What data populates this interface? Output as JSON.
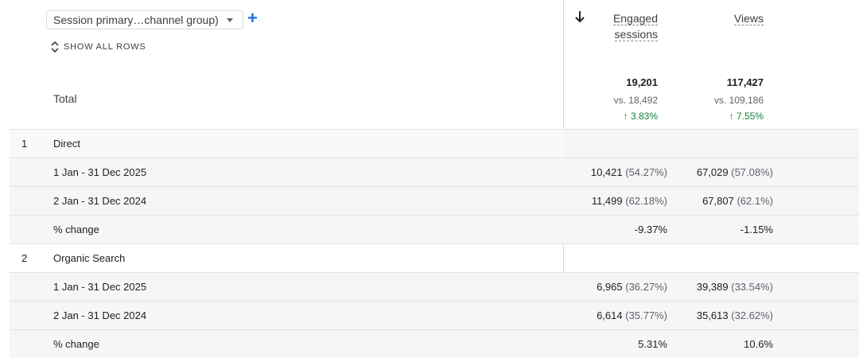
{
  "dimension_selector": {
    "label": "Session primary…channel group)"
  },
  "show_all_rows": {
    "label": "SHOW ALL ROWS"
  },
  "columns": [
    {
      "label_line1": "Engaged",
      "label_line2": "sessions"
    },
    {
      "label_line1": "Views",
      "label_line2": ""
    }
  ],
  "total": {
    "label": "Total",
    "engaged_sessions": {
      "value": "19,201",
      "vs": "vs. 18,492",
      "change": "↑ 3.83%"
    },
    "views": {
      "value": "117,427",
      "vs": "vs. 109,186",
      "change": "↑ 7.55%"
    }
  },
  "groups": [
    {
      "index": "1",
      "name": "Direct",
      "rows": [
        {
          "label": "1 Jan - 31 Dec 2025",
          "c1_val": "10,421",
          "c1_pct": "(54.27%)",
          "c2_val": "67,029",
          "c2_pct": "(57.08%)"
        },
        {
          "label": "2 Jan - 31 Dec 2024",
          "c1_val": "11,499",
          "c1_pct": "(62.18%)",
          "c2_val": "67,807",
          "c2_pct": "(62.1%)"
        },
        {
          "label": "% change",
          "c1_val": "-9.37%",
          "c1_pct": "",
          "c2_val": "-1.15%",
          "c2_pct": ""
        }
      ]
    },
    {
      "index": "2",
      "name": "Organic Search",
      "rows": [
        {
          "label": "1 Jan - 31 Dec 2025",
          "c1_val": "6,965",
          "c1_pct": "(36.27%)",
          "c2_val": "39,389",
          "c2_pct": "(33.54%)"
        },
        {
          "label": "2 Jan - 31 Dec 2024",
          "c1_val": "6,614",
          "c1_pct": "(35.77%)",
          "c2_val": "35,613",
          "c2_pct": "(32.62%)"
        },
        {
          "label": "% change",
          "c1_val": "5.31%",
          "c1_pct": "",
          "c2_val": "10.6%",
          "c2_pct": ""
        }
      ]
    }
  ],
  "colors": {
    "accent": "#1a73e8",
    "positive": "#188038",
    "muted": "#5f6368"
  }
}
